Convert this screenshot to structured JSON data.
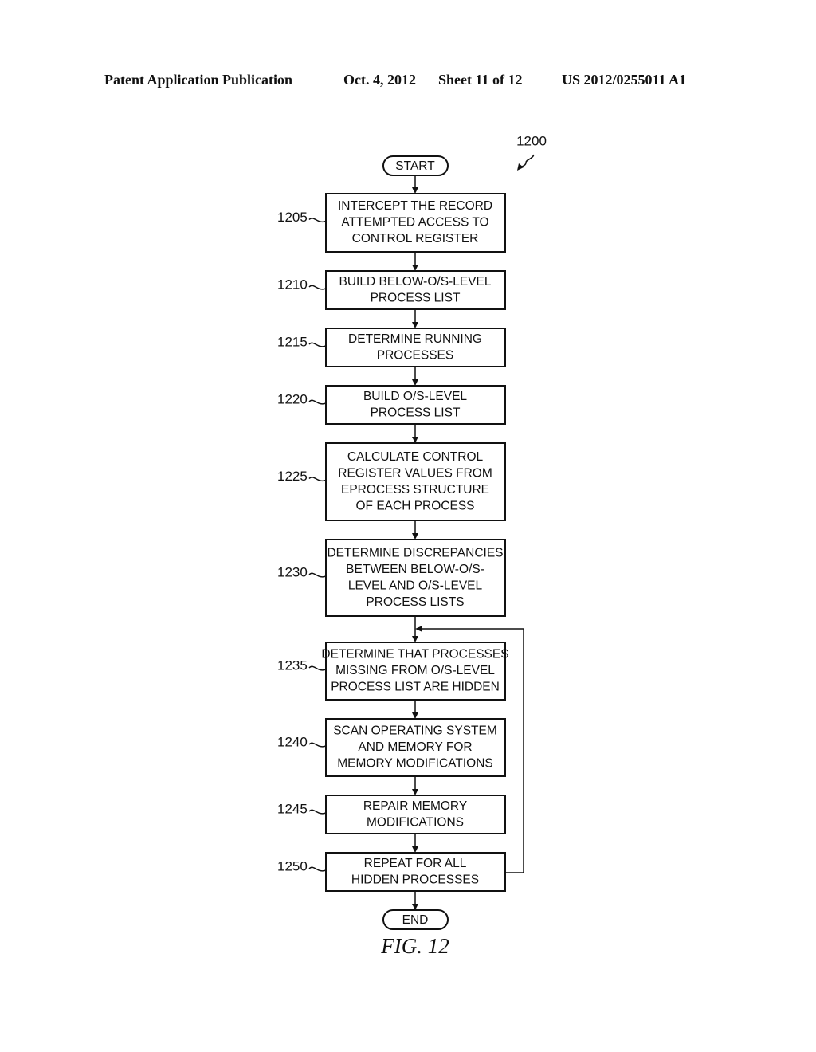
{
  "header": {
    "publication": "Patent Application Publication",
    "date": "Oct. 4, 2012",
    "sheet": "Sheet 11 of 12",
    "number": "US 2012/0255011 A1"
  },
  "diagram": {
    "ref": "1200",
    "start_label": "START",
    "end_label": "END",
    "figure_label": "FIG. 12",
    "steps": [
      {
        "ref": "1205",
        "lines": [
          "INTERCEPT THE RECORD",
          "ATTEMPTED ACCESS TO",
          "CONTROL REGISTER"
        ]
      },
      {
        "ref": "1210",
        "lines": [
          "BUILD BELOW-O/S-LEVEL",
          "PROCESS LIST"
        ]
      },
      {
        "ref": "1215",
        "lines": [
          "DETERMINE RUNNING",
          "PROCESSES"
        ]
      },
      {
        "ref": "1220",
        "lines": [
          "BUILD O/S-LEVEL",
          "PROCESS LIST"
        ]
      },
      {
        "ref": "1225",
        "lines": [
          "CALCULATE CONTROL",
          "REGISTER VALUES FROM",
          "EPROCESS STRUCTURE",
          "OF EACH PROCESS"
        ]
      },
      {
        "ref": "1230",
        "lines": [
          "DETERMINE DISCREPANCIES",
          "BETWEEN BELOW-O/S-",
          "LEVEL AND O/S-LEVEL",
          "PROCESS LISTS"
        ]
      },
      {
        "ref": "1235",
        "lines": [
          "DETERMINE THAT PROCESSES",
          "MISSING FROM O/S-LEVEL",
          "PROCESS LIST ARE HIDDEN"
        ]
      },
      {
        "ref": "1240",
        "lines": [
          "SCAN OPERATING SYSTEM",
          "AND MEMORY FOR",
          "MEMORY MODIFICATIONS"
        ]
      },
      {
        "ref": "1245",
        "lines": [
          "REPAIR MEMORY",
          "MODIFICATIONS"
        ]
      },
      {
        "ref": "1250",
        "lines": [
          "REPEAT FOR ALL",
          "HIDDEN PROCESSES"
        ]
      }
    ],
    "loop": {
      "from_step": "1250",
      "to_step": "1235"
    }
  }
}
